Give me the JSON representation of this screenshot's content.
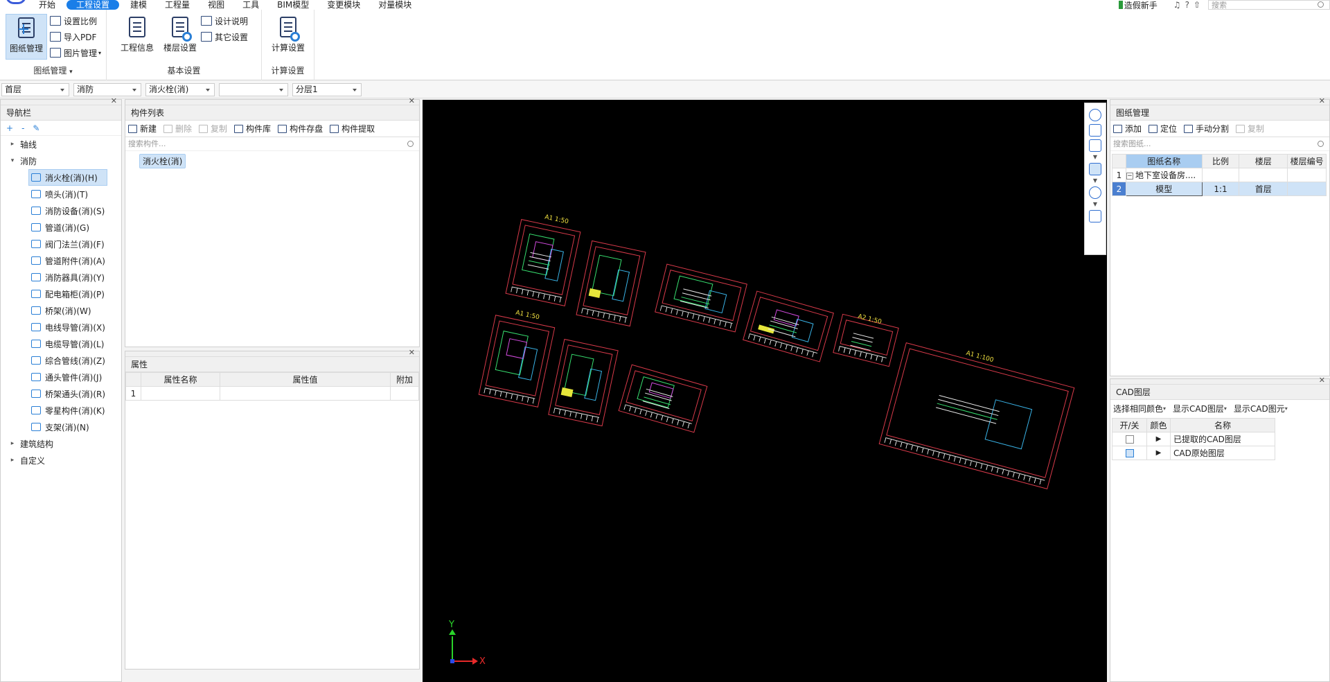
{
  "menu": {
    "items": [
      "开始",
      "工程设置",
      "建模",
      "工程量",
      "视图",
      "工具",
      "BIM模型",
      "变更模块",
      "对量模块"
    ],
    "active_index": 1,
    "guide": "造假新手",
    "search_placeholder": "搜索"
  },
  "ribbon": {
    "drawing_group": {
      "label": "图纸管理",
      "big_button": "图纸管理",
      "small_buttons": [
        "设置比例",
        "导入PDF",
        "图片管理"
      ]
    },
    "basic_group": {
      "label": "基本设置",
      "big_buttons": [
        "工程信息",
        "楼层设置"
      ],
      "small_buttons": [
        "设计说明",
        "其它设置"
      ]
    },
    "calc_group": {
      "label": "计算设置",
      "big_button": "计算设置"
    }
  },
  "filters": [
    "首层",
    "消防",
    "消火栓(消)",
    "",
    "分层1"
  ],
  "navigator": {
    "title": "导航栏",
    "tool_icons": [
      "+",
      "-",
      "✎"
    ],
    "tree": [
      {
        "label": "轴线",
        "expanded": false
      },
      {
        "label": "消防",
        "expanded": true
      },
      {
        "label": "建筑结构",
        "expanded": false
      },
      {
        "label": "自定义",
        "expanded": false
      }
    ],
    "children": [
      "消火栓(消)(H)",
      "喷头(消)(T)",
      "消防设备(消)(S)",
      "管道(消)(G)",
      "阀门法兰(消)(F)",
      "管道附件(消)(A)",
      "消防器具(消)(Y)",
      "配电箱柜(消)(P)",
      "桥架(消)(W)",
      "电线导管(消)(X)",
      "电缆导管(消)(L)",
      "综合管线(消)(Z)",
      "通头管件(消)(J)",
      "桥架通头(消)(R)",
      "零星构件(消)(K)",
      "支架(消)(N)"
    ],
    "selected_child": 0
  },
  "component_list": {
    "title": "构件列表",
    "toolbar": [
      "新建",
      "删除",
      "复制",
      "构件库",
      "构件存盘",
      "构件提取"
    ],
    "disabled": [
      1,
      2
    ],
    "search_placeholder": "搜索构件...",
    "items": [
      "消火栓(消)"
    ]
  },
  "properties": {
    "title": "属性",
    "columns": [
      "属性名称",
      "属性值",
      "附加"
    ],
    "rows": [
      [
        "1",
        "",
        "",
        ""
      ]
    ]
  },
  "canvas": {
    "scale_labels": [
      "A1  1:50",
      "A1  1:50",
      "A2  1:50",
      "A1  1:100"
    ],
    "axis_x": "X",
    "axis_y": "Y",
    "view_icons": [
      "orbit-icon",
      "3d-view-icon",
      "box-view-icon",
      "top-view-icon",
      "rotate-icon",
      "layer-display-icon"
    ]
  },
  "drawing_manager": {
    "title": "图纸管理",
    "toolbar": [
      "添加",
      "定位",
      "手动分割",
      "复制"
    ],
    "search_placeholder": "搜索图纸...",
    "columns": [
      "图纸名称",
      "比例",
      "楼层",
      "楼层编号"
    ],
    "rows": [
      [
        "1",
        "地下室设备房....",
        "",
        "",
        ""
      ],
      [
        "2",
        "模型",
        "1:1",
        "首层",
        ""
      ]
    ],
    "selected_row": 1
  },
  "cad_layers": {
    "title": "CAD图层",
    "toolbar": [
      "选择相同颜色",
      "显示CAD图层",
      "显示CAD图元"
    ],
    "columns": [
      "开/关",
      "颜色",
      "名称"
    ],
    "rows": [
      {
        "name": "已提取的CAD图层",
        "on": false
      },
      {
        "name": "CAD原始图层",
        "on": true
      }
    ]
  }
}
